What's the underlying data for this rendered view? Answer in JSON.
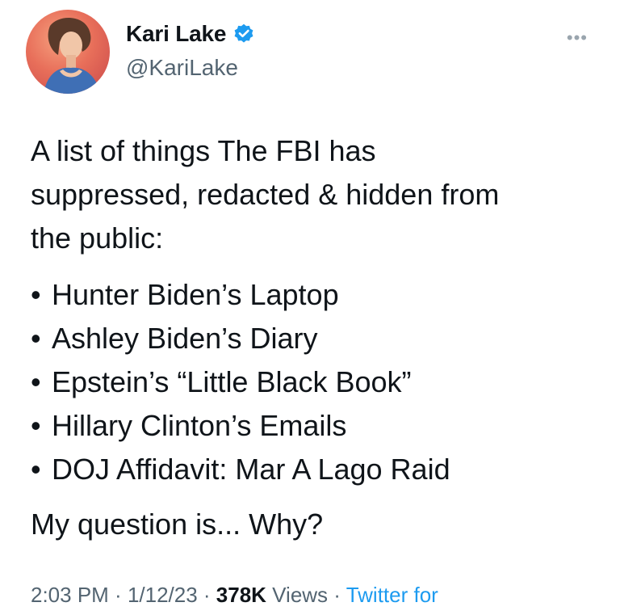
{
  "author": {
    "display_name": "Kari Lake",
    "handle": "@KariLake",
    "verified_color": "#1d9bf0"
  },
  "more_icon": "ellipsis-icon",
  "tweet": {
    "intro_line1": "A list of things The FBI has",
    "intro_line2": "suppressed, redacted & hidden from",
    "intro_line3": "the public:",
    "bullet": "•",
    "items": [
      "Hunter Biden’s Laptop",
      "Ashley Biden’s Diary",
      "Epstein’s “Little Black Book”",
      "Hillary Clinton’s Emails",
      "DOJ Affidavit: Mar A Lago Raid"
    ],
    "question": "My question is... Why?"
  },
  "meta": {
    "time": "2:03 PM",
    "separator": " · ",
    "date": "1/12/23",
    "views_count": "378K",
    "views_label": " Views",
    "source": "Twitter for"
  }
}
